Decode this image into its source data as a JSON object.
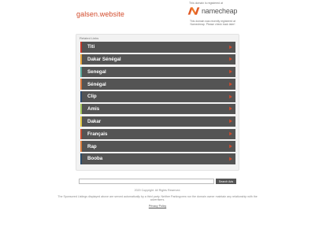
{
  "header": {
    "domain": "galsen.website",
    "registrar_note": "This domain is registered at",
    "registrar_name": "namecheap",
    "registrar_desc": "This domain was recently registered at Namecheap. Please check back later!"
  },
  "related": {
    "heading": "Related Links",
    "items": [
      {
        "label": "Titi",
        "accent": "#c0392b"
      },
      {
        "label": "Dakar Sénégal",
        "accent": "#e6a43a"
      },
      {
        "label": "Senegal",
        "accent": "#58a89a"
      },
      {
        "label": "Sénégal",
        "accent": "#d4733a"
      },
      {
        "label": "Clip",
        "accent": "#2e4a6b"
      },
      {
        "label": "Amis",
        "accent": "#a2c55a"
      },
      {
        "label": "Dakar",
        "accent": "#e1c744"
      },
      {
        "label": "Français",
        "accent": "#c44a2e"
      },
      {
        "label": "Rap",
        "accent": "#d87a3b"
      },
      {
        "label": "Booba",
        "accent": "#2b4c69"
      }
    ],
    "arrow_color": "#d24a2b"
  },
  "search": {
    "placeholder": "",
    "button_label": "Search Ads"
  },
  "footer": {
    "copyright": "2020 Copyright. All Rights Reserved.",
    "disclaimer": "The Sponsored Listings displayed above are served automatically by a third party. Neither Parkingcrew nor the domain owner maintain any relationship with the advertisers.",
    "privacy_label": "Privacy Policy"
  }
}
